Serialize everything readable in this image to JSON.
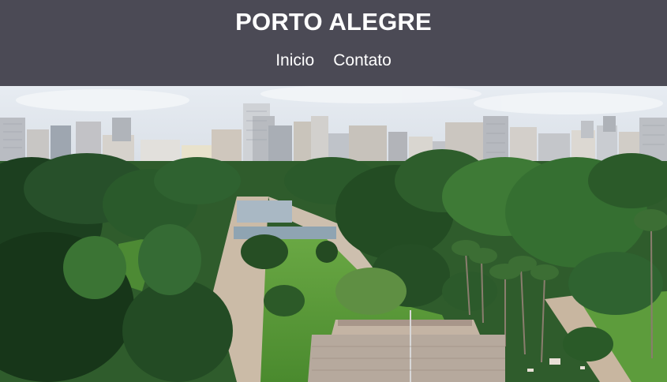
{
  "header": {
    "title": "PORTO ALEGRE",
    "nav": [
      {
        "label": "Inicio"
      },
      {
        "label": "Contato"
      }
    ],
    "background_color": "#4b4a55",
    "text_color": "#ffffff"
  },
  "hero": {
    "colors": {
      "sky": "#dfe6ee",
      "buildings": "#c9c9cc",
      "trees_dark": "#1f4a24",
      "trees_light": "#4f8a36",
      "lawn": "#5a9a3a",
      "path": "#c9b9a6",
      "monument": "#b5a89c"
    }
  }
}
